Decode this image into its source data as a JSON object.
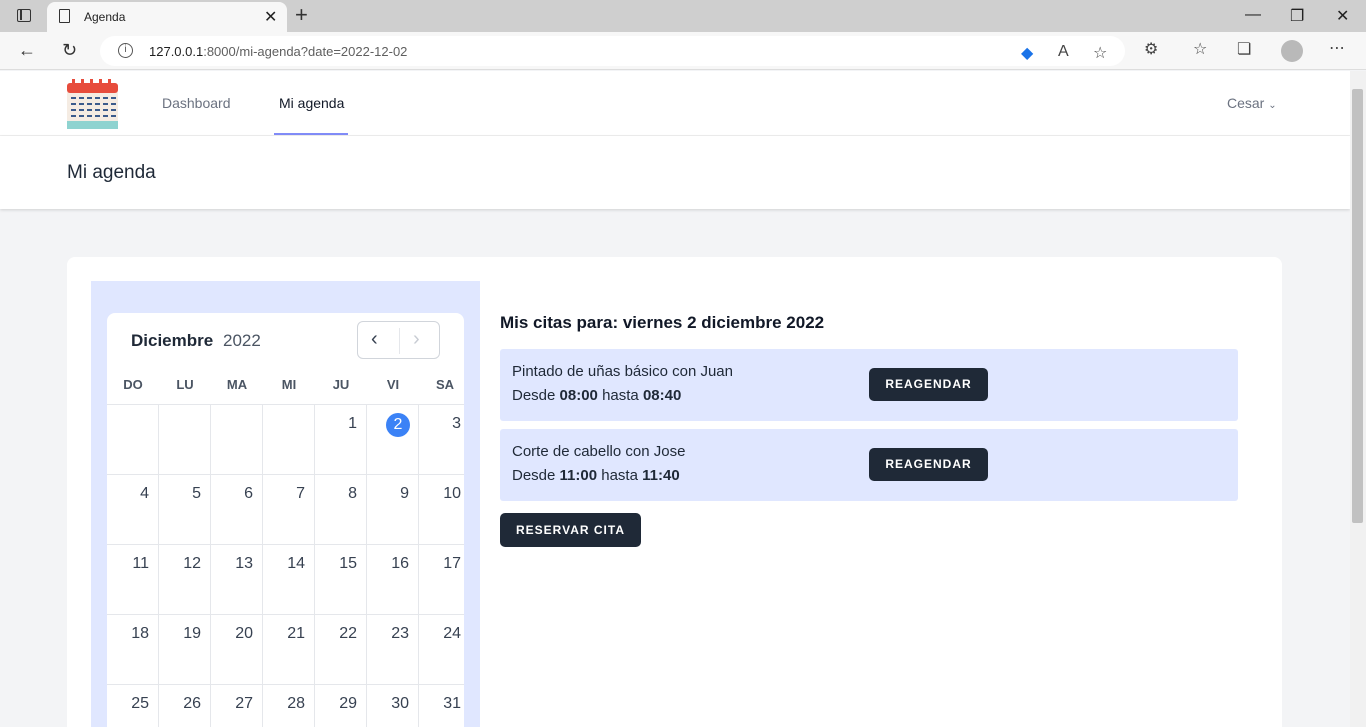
{
  "browser": {
    "tab_title": "Agenda",
    "url_host": "127.0.0.1",
    "url_rest": ":8000/mi-agenda?date=2022-12-02"
  },
  "nav": {
    "links": [
      "Dashboard",
      "Mi agenda"
    ],
    "active": "Mi agenda",
    "user": "Cesar"
  },
  "header": {
    "title": "Mi agenda"
  },
  "calendar": {
    "month": "Diciembre",
    "year": "2022",
    "weekdays": [
      "DO",
      "LU",
      "MA",
      "MI",
      "JU",
      "VI",
      "SA"
    ],
    "days": [
      "",
      "",
      "",
      "",
      "1",
      "2",
      "3",
      "4",
      "5",
      "6",
      "7",
      "8",
      "9",
      "10",
      "11",
      "12",
      "13",
      "14",
      "15",
      "16",
      "17",
      "18",
      "19",
      "20",
      "21",
      "22",
      "23",
      "24",
      "25",
      "26",
      "27",
      "28",
      "29",
      "30",
      "31"
    ],
    "selected_day": "2",
    "selected_color": "#3b82f6"
  },
  "citas": {
    "heading": "Mis citas para: viernes 2 diciembre 2022",
    "items": [
      {
        "title": "Pintado de uñas básico con Juan",
        "desde_label": "Desde",
        "start": "08:00",
        "hasta_label": "hasta",
        "end": "08:40",
        "button": "REAGENDAR"
      },
      {
        "title": "Corte de cabello con Jose",
        "desde_label": "Desde",
        "start": "11:00",
        "hasta_label": "hasta",
        "end": "11:40",
        "button": "REAGENDAR"
      }
    ],
    "reserve_button": "RESERVAR CITA"
  }
}
